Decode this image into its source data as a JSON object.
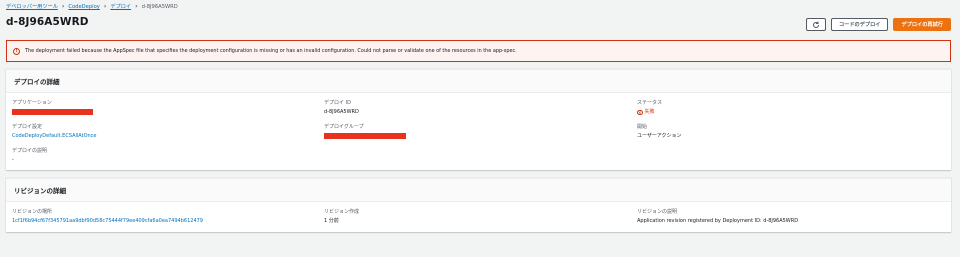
{
  "breadcrumb": {
    "items": [
      "デベロッパー用ツール",
      "CodeDeploy",
      "デプロイ"
    ],
    "current": "d-8J96A5WRD"
  },
  "header": {
    "title": "d-8J96A5WRD",
    "refresh_icon": "refresh-icon",
    "code_deploy_label": "コードのデプロイ",
    "retry_label": "デプロイの再試行"
  },
  "alert": {
    "icon": "error-icon",
    "message": "The deployment failed because the AppSpec file that specifies the deployment configuration is missing or has an invalid configuration. Could not parse or validate one of the resources in the app-spec."
  },
  "deployment_details": {
    "title": "デプロイの詳細",
    "application_label": "アプリケーション",
    "deployment_id_label": "デプロイ ID",
    "deployment_id": "d-8J96A5WRD",
    "status_label": "ステータス",
    "status_value": "失敗",
    "config_label": "デプロイ設定",
    "config_value": "CodeDeployDefault.ECSAllAtOnce",
    "group_label": "デプロイグループ",
    "start_label": "開始",
    "start_value": "ユーザーアクション",
    "description_label": "デプロイの説明",
    "description_value": "-"
  },
  "revision_details": {
    "title": "リビジョンの詳細",
    "location_label": "リビジョンの場所",
    "location_value": "1cf1f6b94cf67f345791aa9dbf90d58c75444f79ee409cfa6a0ea7494b612479",
    "created_label": "リビジョン作成",
    "created_value": "1 分前",
    "description_label": "リビジョンの説明",
    "description_value": "Application revision registered by Deployment ID: d-8J96A5WRD"
  },
  "colors": {
    "link": "#0073bb",
    "error": "#d13212",
    "primary": "#ec7211",
    "redaction": "#e8321e"
  }
}
